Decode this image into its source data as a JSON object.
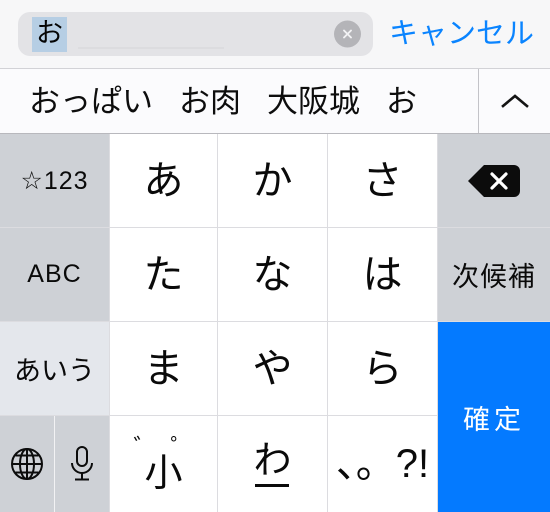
{
  "search": {
    "value": "お",
    "composing": true,
    "clear_icon": "clear-circle-icon",
    "cancel_label": "キャンセル",
    "accent_color": "#0a84ff",
    "highlight_color": "#b6cee4",
    "field_bg": "#e3e3e6"
  },
  "candidate_bar": {
    "candidates": [
      {
        "label": "おっぱい"
      },
      {
        "label": "お肉"
      },
      {
        "label": "大阪城"
      },
      {
        "label": "お"
      }
    ],
    "expand_icon": "chevron-up-icon"
  },
  "keyboard": {
    "rows": [
      {
        "keys": [
          {
            "id": "symbols",
            "label": "☆123",
            "type": "fn"
          },
          {
            "id": "a-row",
            "label": "あ",
            "type": "kana"
          },
          {
            "id": "ka-row",
            "label": "か",
            "type": "kana"
          },
          {
            "id": "sa-row",
            "label": "さ",
            "type": "kana"
          },
          {
            "id": "delete",
            "label": "",
            "type": "fn",
            "icon": "delete-key-icon"
          }
        ]
      },
      {
        "keys": [
          {
            "id": "abc",
            "label": "ABC",
            "type": "fn"
          },
          {
            "id": "ta-row",
            "label": "た",
            "type": "kana"
          },
          {
            "id": "na-row",
            "label": "な",
            "type": "kana"
          },
          {
            "id": "ha-row",
            "label": "は",
            "type": "kana"
          },
          {
            "id": "next-candidate",
            "label": "次候補",
            "type": "fn-jp"
          }
        ]
      },
      {
        "keys": [
          {
            "id": "kana-mode",
            "label": "あいう",
            "type": "fn-active"
          },
          {
            "id": "ma-row",
            "label": "ま",
            "type": "kana"
          },
          {
            "id": "ya-row",
            "label": "や",
            "type": "kana"
          },
          {
            "id": "ra-row",
            "label": "ら",
            "type": "kana"
          },
          {
            "id": "confirm",
            "label": "確定",
            "type": "accent"
          }
        ]
      },
      {
        "keys": [
          {
            "id": "globe",
            "label": "",
            "type": "fn",
            "icon": "globe-icon"
          },
          {
            "id": "dictation",
            "label": "",
            "type": "fn",
            "icon": "microphone-icon"
          },
          {
            "id": "small-dakuten",
            "marks": "゛゜",
            "label": "小",
            "type": "kana"
          },
          {
            "id": "wa-row",
            "label": "わ",
            "underscore": true,
            "type": "kana"
          },
          {
            "id": "punctuation",
            "label": "、。?!",
            "type": "kana"
          }
        ]
      }
    ],
    "colors": {
      "key_bg": "#ffffff",
      "fn_bg": "#ced1d6",
      "fn_active_bg": "#e4e7ec",
      "accent_bg": "#047aff",
      "separator": "#dcdce0"
    }
  }
}
